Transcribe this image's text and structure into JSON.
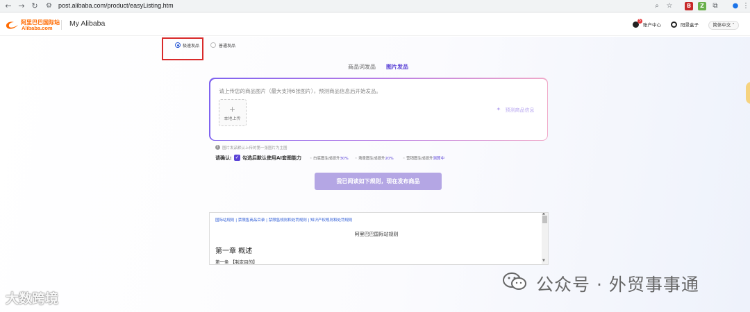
{
  "browser": {
    "url": "post.alibaba.com/product/easyListing.htm",
    "extension_colors": [
      "#c62828",
      "#6ab04c"
    ]
  },
  "header": {
    "logo_cn": "阿里巴巴国际站",
    "logo_en": "Alibaba.com",
    "title": "My Alibaba",
    "account_center": "账户中心",
    "username": "阳景盒子",
    "language": "简体中文",
    "notification_count": "5"
  },
  "listing_mode": {
    "options": [
      {
        "label": "极速发品",
        "selected": true
      },
      {
        "label": "普通发品",
        "selected": false
      }
    ]
  },
  "tabs": [
    {
      "label": "商品词发品",
      "active": false
    },
    {
      "label": "图片发品",
      "active": true
    }
  ],
  "upload": {
    "hint": "请上传您的商品图片（最大支持6张图片），预测商品信息后开始发品。",
    "button_plus": "+",
    "button_label": "本地上传",
    "predict_label": "预测商品信息"
  },
  "note": "图片发品默认上传的第一张图片为主图",
  "confirm": {
    "label": "请确认:",
    "text": "勾选后默认使用AI套图能力",
    "features": [
      {
        "text": "白底图生成提升",
        "value": "30%"
      },
      {
        "text": "场景图生成提升",
        "value": "20%"
      },
      {
        "text": "营销图生成提升",
        "value": "测算中"
      }
    ]
  },
  "publish_button": "我已阅读如下规则，现在发布商品",
  "rules": {
    "links": "国际站规则 | 禁限售商品目录 | 禁限售规则和处罚规则 | 知识产权规则和处罚规则",
    "title": "阿里巴巴国际站规则",
    "chapter": "第一章 概述",
    "article": "第一条 【制定目的】"
  },
  "watermarks": {
    "left": "大数跨境",
    "right": "公众号 · 外贸事事通"
  },
  "colors": {
    "brand_orange": "#ff6a00",
    "accent_purple": "#5b43d6",
    "highlight_red": "#d92a2a"
  }
}
